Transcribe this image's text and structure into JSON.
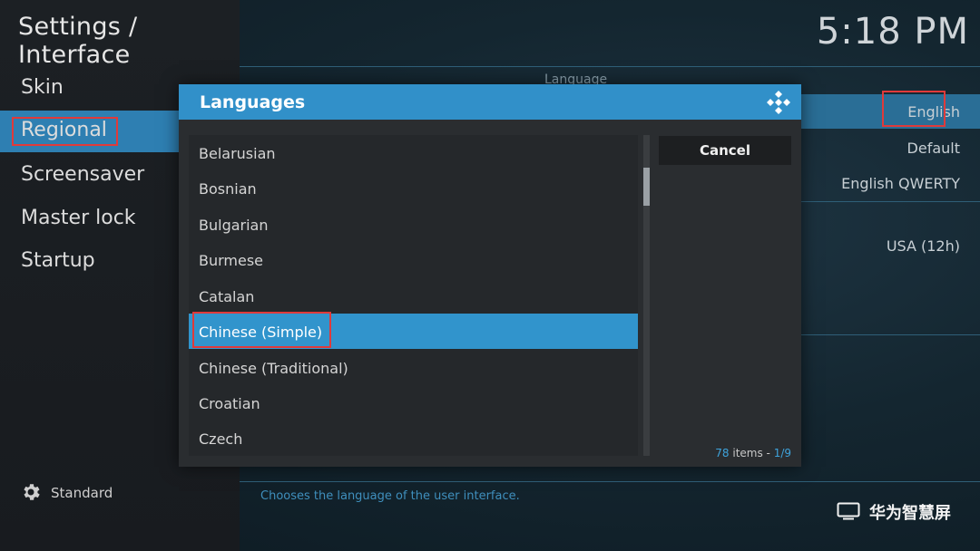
{
  "header": {
    "title": "Settings / Interface",
    "clock": "5:18 PM"
  },
  "sidebar": {
    "items": [
      {
        "label": "Skin"
      },
      {
        "label": "Regional"
      },
      {
        "label": "Screensaver"
      },
      {
        "label": "Master lock"
      },
      {
        "label": "Startup"
      }
    ],
    "active_index": 1,
    "level_label": "Standard",
    "level_icon": "gear-icon"
  },
  "settings": {
    "section_label": "Language",
    "rows": [
      {
        "value": "English"
      },
      {
        "value": "Default"
      },
      {
        "value": "English QWERTY"
      },
      {
        "value": "USA (12h)"
      }
    ],
    "help_text": "Chooses the language of the user interface."
  },
  "dialog": {
    "title": "Languages",
    "logo_icon": "kodi-logo-icon",
    "items": [
      {
        "label": "Belarusian"
      },
      {
        "label": "Bosnian"
      },
      {
        "label": "Bulgarian"
      },
      {
        "label": "Burmese"
      },
      {
        "label": "Catalan"
      },
      {
        "label": "Chinese (Simple)"
      },
      {
        "label": "Chinese (Traditional)"
      },
      {
        "label": "Croatian"
      },
      {
        "label": "Czech"
      }
    ],
    "selected_index": 5,
    "cancel_label": "Cancel",
    "items_count": "78",
    "items_word": " items - ",
    "page": "1/9"
  },
  "brand": {
    "text": "华为智慧屏",
    "icon": "tv-icon"
  },
  "colors": {
    "accent": "#3194cc",
    "annotation": "#e03a3a",
    "sidebar_active": "#2e7fb2"
  }
}
